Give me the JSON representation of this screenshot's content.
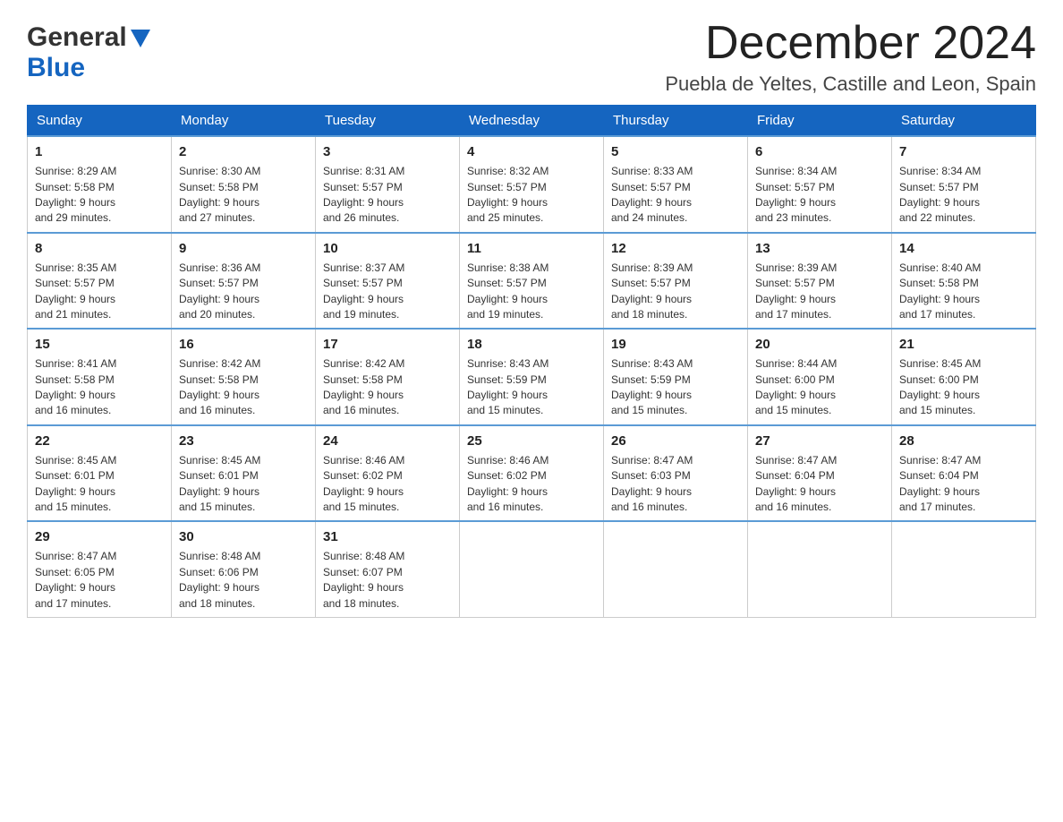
{
  "header": {
    "logo_general": "General",
    "logo_blue": "Blue",
    "month_title": "December 2024",
    "location": "Puebla de Yeltes, Castille and Leon, Spain"
  },
  "weekdays": [
    "Sunday",
    "Monday",
    "Tuesday",
    "Wednesday",
    "Thursday",
    "Friday",
    "Saturday"
  ],
  "weeks": [
    [
      {
        "day": "1",
        "sunrise": "8:29 AM",
        "sunset": "5:58 PM",
        "daylight": "9 hours and 29 minutes."
      },
      {
        "day": "2",
        "sunrise": "8:30 AM",
        "sunset": "5:58 PM",
        "daylight": "9 hours and 27 minutes."
      },
      {
        "day": "3",
        "sunrise": "8:31 AM",
        "sunset": "5:57 PM",
        "daylight": "9 hours and 26 minutes."
      },
      {
        "day": "4",
        "sunrise": "8:32 AM",
        "sunset": "5:57 PM",
        "daylight": "9 hours and 25 minutes."
      },
      {
        "day": "5",
        "sunrise": "8:33 AM",
        "sunset": "5:57 PM",
        "daylight": "9 hours and 24 minutes."
      },
      {
        "day": "6",
        "sunrise": "8:34 AM",
        "sunset": "5:57 PM",
        "daylight": "9 hours and 23 minutes."
      },
      {
        "day": "7",
        "sunrise": "8:34 AM",
        "sunset": "5:57 PM",
        "daylight": "9 hours and 22 minutes."
      }
    ],
    [
      {
        "day": "8",
        "sunrise": "8:35 AM",
        "sunset": "5:57 PM",
        "daylight": "9 hours and 21 minutes."
      },
      {
        "day": "9",
        "sunrise": "8:36 AM",
        "sunset": "5:57 PM",
        "daylight": "9 hours and 20 minutes."
      },
      {
        "day": "10",
        "sunrise": "8:37 AM",
        "sunset": "5:57 PM",
        "daylight": "9 hours and 19 minutes."
      },
      {
        "day": "11",
        "sunrise": "8:38 AM",
        "sunset": "5:57 PM",
        "daylight": "9 hours and 19 minutes."
      },
      {
        "day": "12",
        "sunrise": "8:39 AM",
        "sunset": "5:57 PM",
        "daylight": "9 hours and 18 minutes."
      },
      {
        "day": "13",
        "sunrise": "8:39 AM",
        "sunset": "5:57 PM",
        "daylight": "9 hours and 17 minutes."
      },
      {
        "day": "14",
        "sunrise": "8:40 AM",
        "sunset": "5:58 PM",
        "daylight": "9 hours and 17 minutes."
      }
    ],
    [
      {
        "day": "15",
        "sunrise": "8:41 AM",
        "sunset": "5:58 PM",
        "daylight": "9 hours and 16 minutes."
      },
      {
        "day": "16",
        "sunrise": "8:42 AM",
        "sunset": "5:58 PM",
        "daylight": "9 hours and 16 minutes."
      },
      {
        "day": "17",
        "sunrise": "8:42 AM",
        "sunset": "5:58 PM",
        "daylight": "9 hours and 16 minutes."
      },
      {
        "day": "18",
        "sunrise": "8:43 AM",
        "sunset": "5:59 PM",
        "daylight": "9 hours and 15 minutes."
      },
      {
        "day": "19",
        "sunrise": "8:43 AM",
        "sunset": "5:59 PM",
        "daylight": "9 hours and 15 minutes."
      },
      {
        "day": "20",
        "sunrise": "8:44 AM",
        "sunset": "6:00 PM",
        "daylight": "9 hours and 15 minutes."
      },
      {
        "day": "21",
        "sunrise": "8:45 AM",
        "sunset": "6:00 PM",
        "daylight": "9 hours and 15 minutes."
      }
    ],
    [
      {
        "day": "22",
        "sunrise": "8:45 AM",
        "sunset": "6:01 PM",
        "daylight": "9 hours and 15 minutes."
      },
      {
        "day": "23",
        "sunrise": "8:45 AM",
        "sunset": "6:01 PM",
        "daylight": "9 hours and 15 minutes."
      },
      {
        "day": "24",
        "sunrise": "8:46 AM",
        "sunset": "6:02 PM",
        "daylight": "9 hours and 15 minutes."
      },
      {
        "day": "25",
        "sunrise": "8:46 AM",
        "sunset": "6:02 PM",
        "daylight": "9 hours and 16 minutes."
      },
      {
        "day": "26",
        "sunrise": "8:47 AM",
        "sunset": "6:03 PM",
        "daylight": "9 hours and 16 minutes."
      },
      {
        "day": "27",
        "sunrise": "8:47 AM",
        "sunset": "6:04 PM",
        "daylight": "9 hours and 16 minutes."
      },
      {
        "day": "28",
        "sunrise": "8:47 AM",
        "sunset": "6:04 PM",
        "daylight": "9 hours and 17 minutes."
      }
    ],
    [
      {
        "day": "29",
        "sunrise": "8:47 AM",
        "sunset": "6:05 PM",
        "daylight": "9 hours and 17 minutes."
      },
      {
        "day": "30",
        "sunrise": "8:48 AM",
        "sunset": "6:06 PM",
        "daylight": "9 hours and 18 minutes."
      },
      {
        "day": "31",
        "sunrise": "8:48 AM",
        "sunset": "6:07 PM",
        "daylight": "9 hours and 18 minutes."
      },
      null,
      null,
      null,
      null
    ]
  ],
  "labels": {
    "sunrise": "Sunrise:",
    "sunset": "Sunset:",
    "daylight": "Daylight:"
  }
}
